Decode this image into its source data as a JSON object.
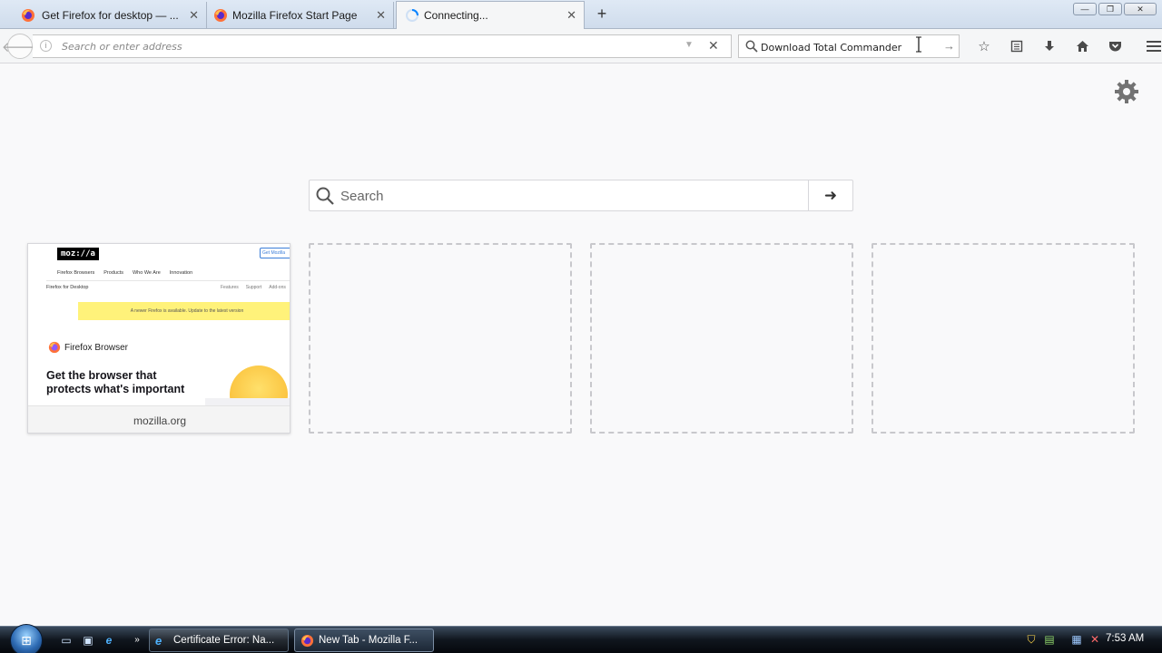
{
  "tabs": [
    {
      "title": "Get Firefox for desktop — ...",
      "icon": "firefox-icon",
      "close": "✕"
    },
    {
      "title": "Mozilla Firefox Start Page",
      "icon": "firefox-icon",
      "close": "✕"
    },
    {
      "title": "Connecting...",
      "icon": "loading-spinner-icon",
      "close": "✕",
      "active": true
    }
  ],
  "new_tab_label": "+",
  "window_controls": {
    "minimize": "—",
    "maximize": "❐",
    "close": "✕"
  },
  "navbar": {
    "url_placeholder": "Search or enter address",
    "url_value": "",
    "search_value": "Download Total Commander"
  },
  "newtab_page": {
    "search_placeholder": "Search",
    "tiles": [
      {
        "caption": "mozilla.org",
        "thumbnail": {
          "logo": "moz://a",
          "top_button": "Get Mozilla",
          "menu": [
            "Firefox Browsers",
            "Products",
            "Who We Are",
            "Innovation"
          ],
          "subtitle": "Firefox for Desktop",
          "subnav": [
            "Features",
            "Support",
            "Add-ons"
          ],
          "banner": "A newer Firefox is available. Update to the latest version",
          "brand": "Firefox Browser",
          "headline": "Get the browser that protects what's important"
        }
      },
      {
        "caption": ""
      },
      {
        "caption": ""
      },
      {
        "caption": ""
      }
    ]
  },
  "taskbar": {
    "buttons": [
      {
        "label": "Certificate Error: Na...",
        "icon": "internet-explorer-icon"
      },
      {
        "label": "New Tab - Mozilla F...",
        "icon": "firefox-icon",
        "active": true
      }
    ],
    "clock": "7:53 AM"
  },
  "colors": {
    "accent": "#0a84ff",
    "tab_strip": "#cfdcec",
    "page_bg": "#f9f9fa"
  }
}
